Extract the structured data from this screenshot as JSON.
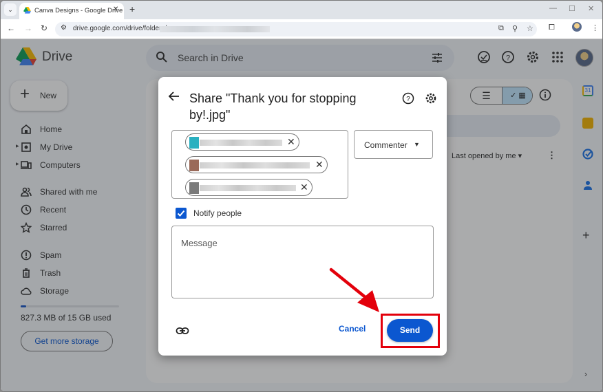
{
  "browser": {
    "tab_title": "Canva Designs - Google Drive",
    "tab_close": "✕",
    "new_tab": "+",
    "url": "drive.google.com/drive/folders/",
    "window_controls": {
      "minimize": "—",
      "maximize": "☐",
      "close": "✕"
    },
    "nav": {
      "back": "←",
      "forward": "→",
      "reload": "↻"
    },
    "menu_dots": "⋮"
  },
  "drive": {
    "logo_text": "Drive",
    "search_placeholder": "Search in Drive",
    "new_button": "New",
    "sidebar": {
      "items": [
        {
          "label": "Home",
          "icon": "home-icon"
        },
        {
          "label": "My Drive",
          "icon": "my-drive-icon",
          "expandable": true
        },
        {
          "label": "Computers",
          "icon": "computers-icon",
          "expandable": true
        },
        {
          "label": "Shared with me",
          "icon": "shared-icon"
        },
        {
          "label": "Recent",
          "icon": "clock-icon"
        },
        {
          "label": "Starred",
          "icon": "star-icon"
        },
        {
          "label": "Spam",
          "icon": "spam-icon"
        },
        {
          "label": "Trash",
          "icon": "trash-icon"
        },
        {
          "label": "Storage",
          "icon": "cloud-icon"
        }
      ]
    },
    "storage": {
      "used_fraction": 0.055,
      "text": "827.3 MB of 15 GB used",
      "button": "Get more storage"
    },
    "main": {
      "view_list_glyph": "☰",
      "view_grid_glyph": "✓ ▦",
      "sort_label": "Last opened by me",
      "sort_caret": "▾",
      "more_glyph": "⋮"
    },
    "side_panel": {
      "add_glyph": "+",
      "expand_glyph": "›",
      "calendar_day": "31"
    }
  },
  "dialog": {
    "title": "Share \"Thank you for stopping by!.jpg\"",
    "recipients": [
      {
        "avatar_color": "#2ab0c0",
        "remove": "✕"
      },
      {
        "avatar_color": "#9a6a5a",
        "remove": "✕"
      },
      {
        "avatar_color": "#7a7a7a",
        "remove": "✕"
      }
    ],
    "role": "Commenter",
    "role_caret": "▼",
    "notify_label": "Notify people",
    "notify_checked": true,
    "message_placeholder": "Message",
    "cancel": "Cancel",
    "send": "Send"
  },
  "colors": {
    "accent": "#0b57d0",
    "annotation_red": "#e3000b",
    "overlay": "rgba(32,33,36,0.38)"
  }
}
